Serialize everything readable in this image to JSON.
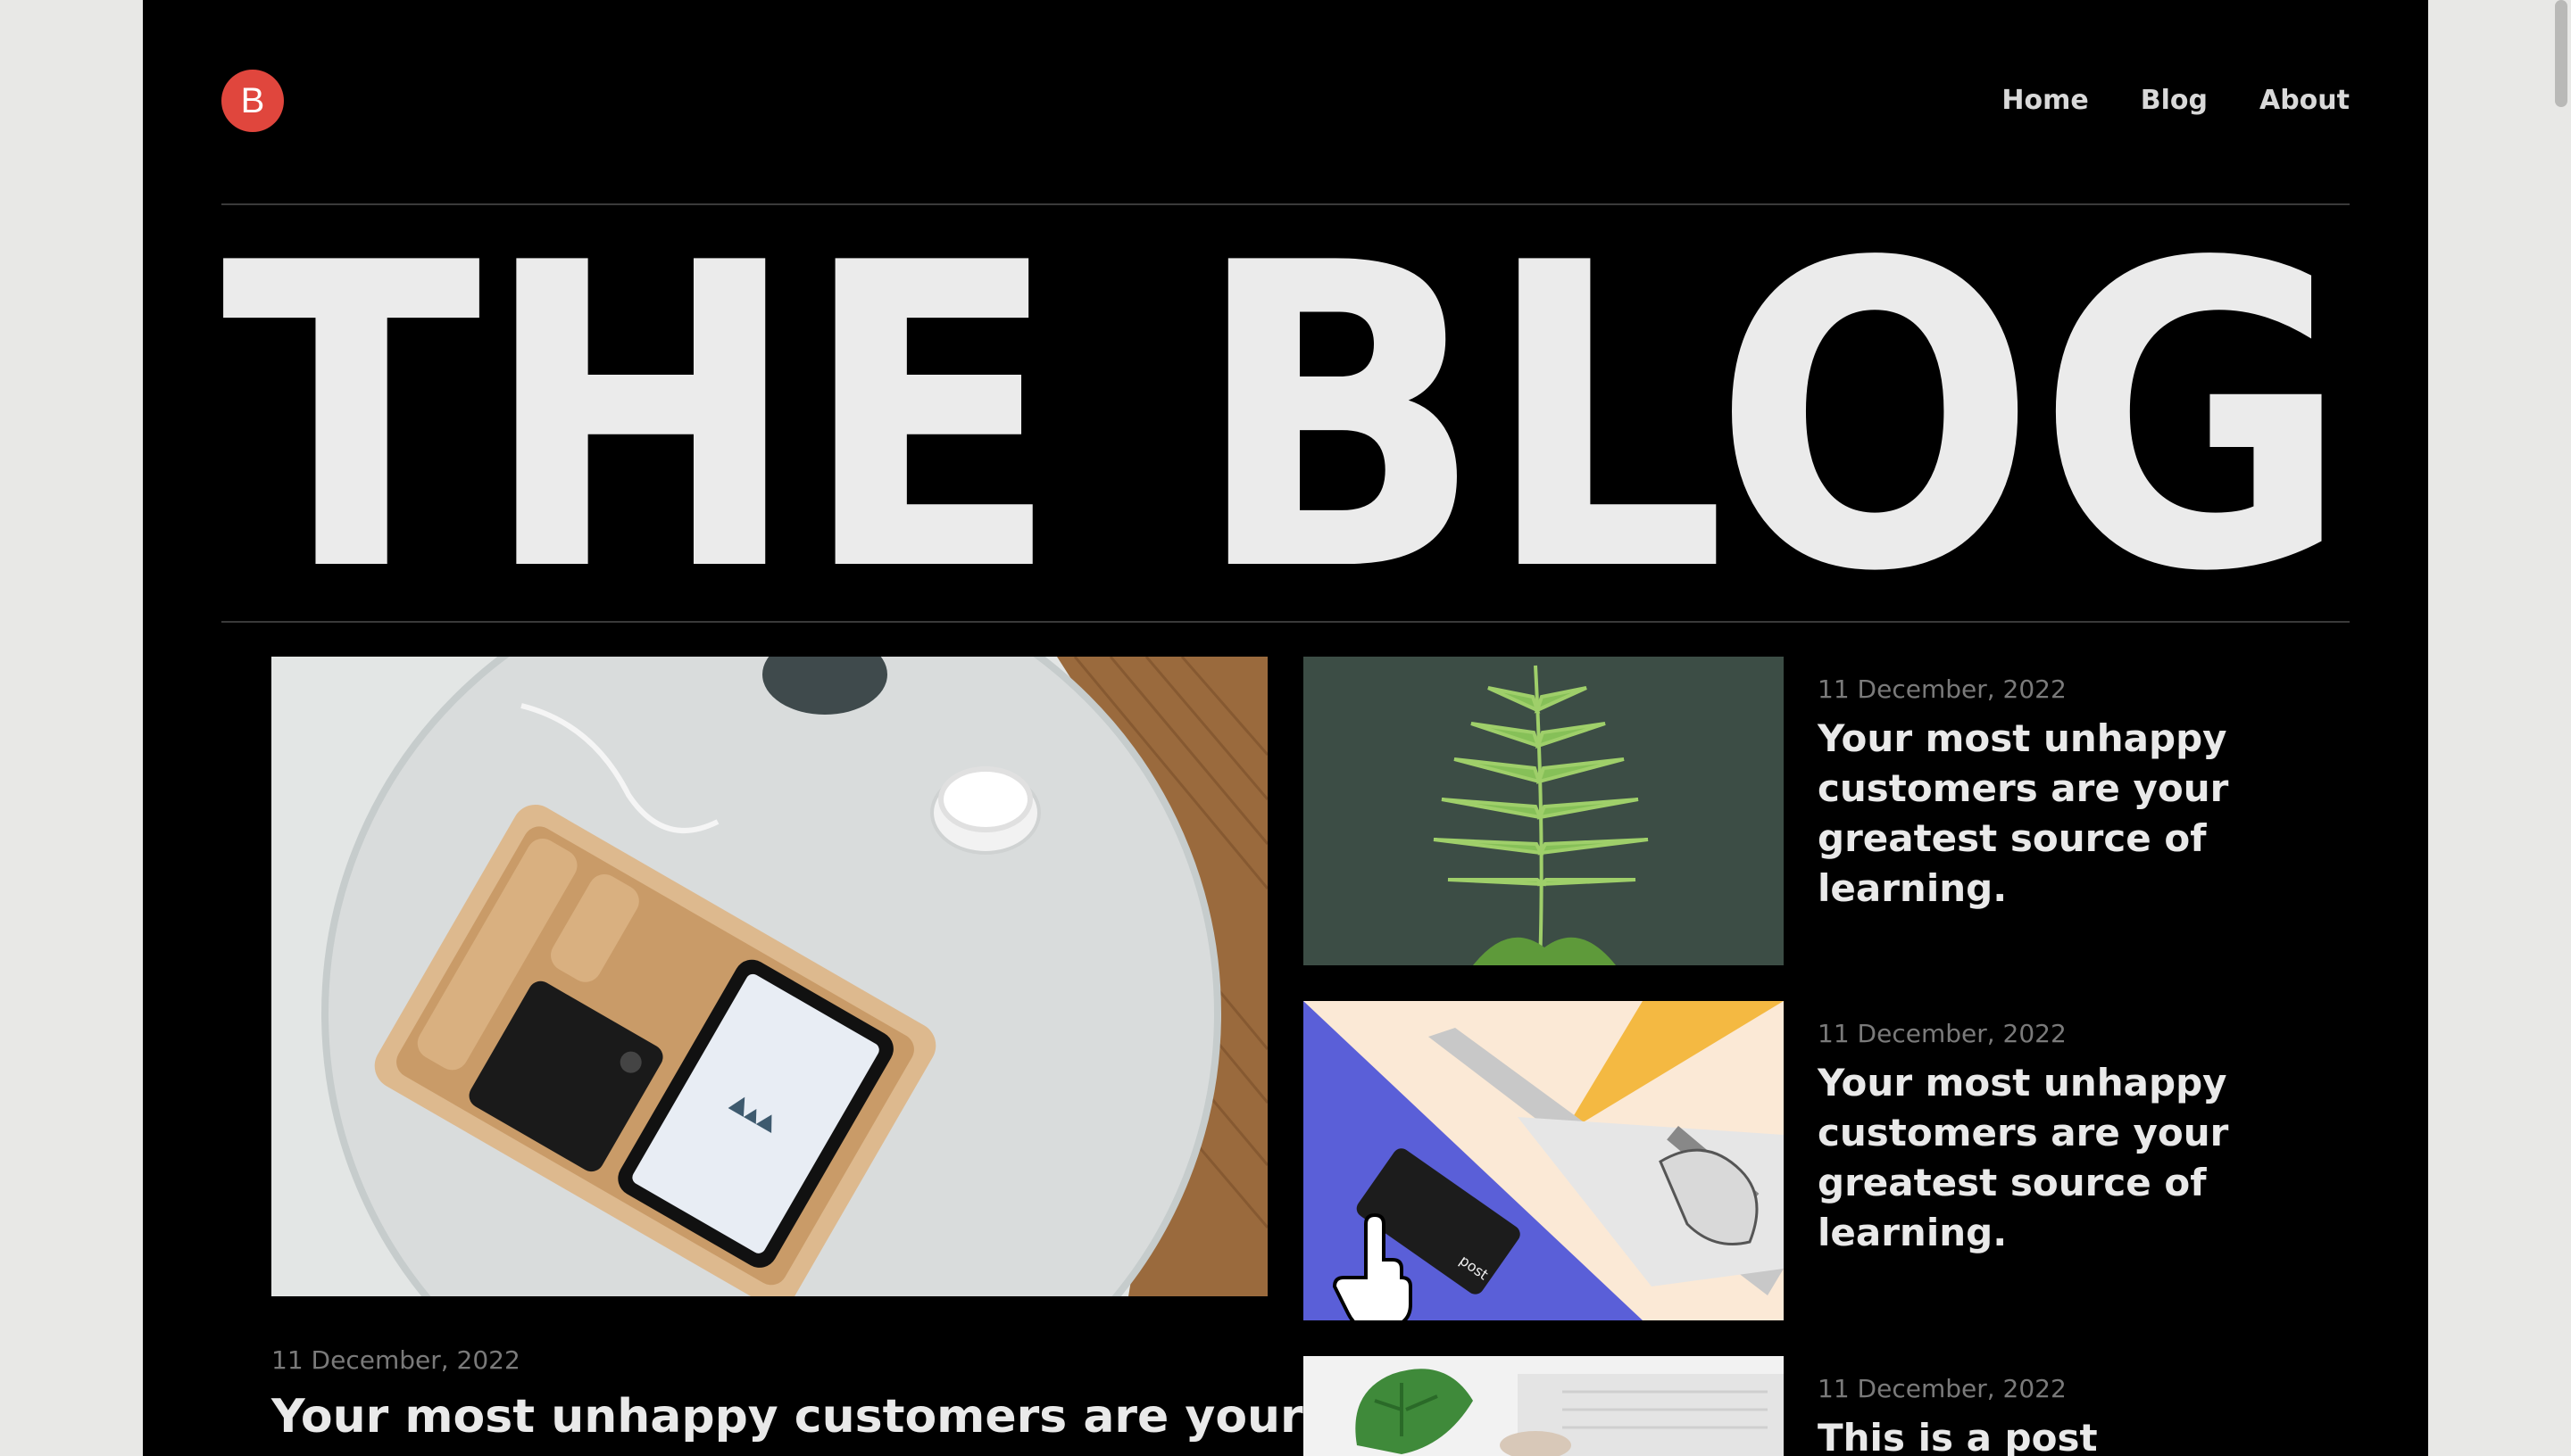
{
  "header": {
    "logo_letter": "B",
    "nav": [
      "Home",
      "Blog",
      "About"
    ]
  },
  "hero": {
    "title": "THE BLOG"
  },
  "featured": {
    "date": "11 December, 2022",
    "title": "Your most unhappy customers are your"
  },
  "side_posts": [
    {
      "date": "11 December, 2022",
      "title": "Your most unhappy customers are your greatest source of learning."
    },
    {
      "date": "11 December, 2022",
      "title": "Your most unhappy customers are your greatest source of learning."
    },
    {
      "date": "11 December, 2022",
      "title": "This is a post"
    }
  ],
  "images": {
    "card_label": "post"
  },
  "colors": {
    "page_bg": "#000000",
    "outer_bg": "#e8e8e6",
    "logo": "#e0463d",
    "text": "#e9e9e9",
    "muted": "#7a7a7a"
  }
}
